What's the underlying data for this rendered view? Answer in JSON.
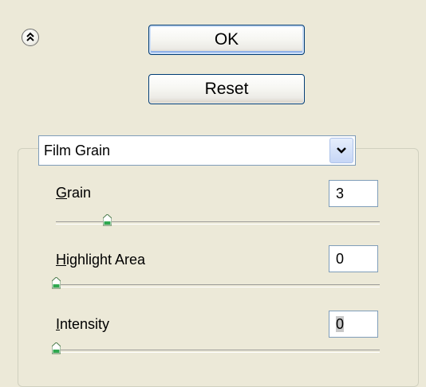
{
  "buttons": {
    "ok_label": "OK",
    "reset_label": "Reset"
  },
  "filter_select": {
    "value": "Film Grain"
  },
  "params": [
    {
      "label_prefix": "",
      "label_mnemonic": "G",
      "label_rest": "rain",
      "value": "3",
      "slider_fraction": 0.16
    },
    {
      "label_prefix": "",
      "label_mnemonic": "H",
      "label_rest": "ighlight Area",
      "value": "0",
      "slider_fraction": 0.0
    },
    {
      "label_prefix": "",
      "label_mnemonic": "I",
      "label_rest": "ntensity",
      "value": "0",
      "slider_fraction": 0.0
    }
  ],
  "icons": {
    "collapse": "double-chevron-up-icon",
    "dropdown": "chevron-down-icon",
    "slider_thumb": "slider-thumb-icon"
  },
  "colors": {
    "background": "#ece9d8",
    "thumb_green": "#2fa84f",
    "field_border": "#7f9db9"
  }
}
